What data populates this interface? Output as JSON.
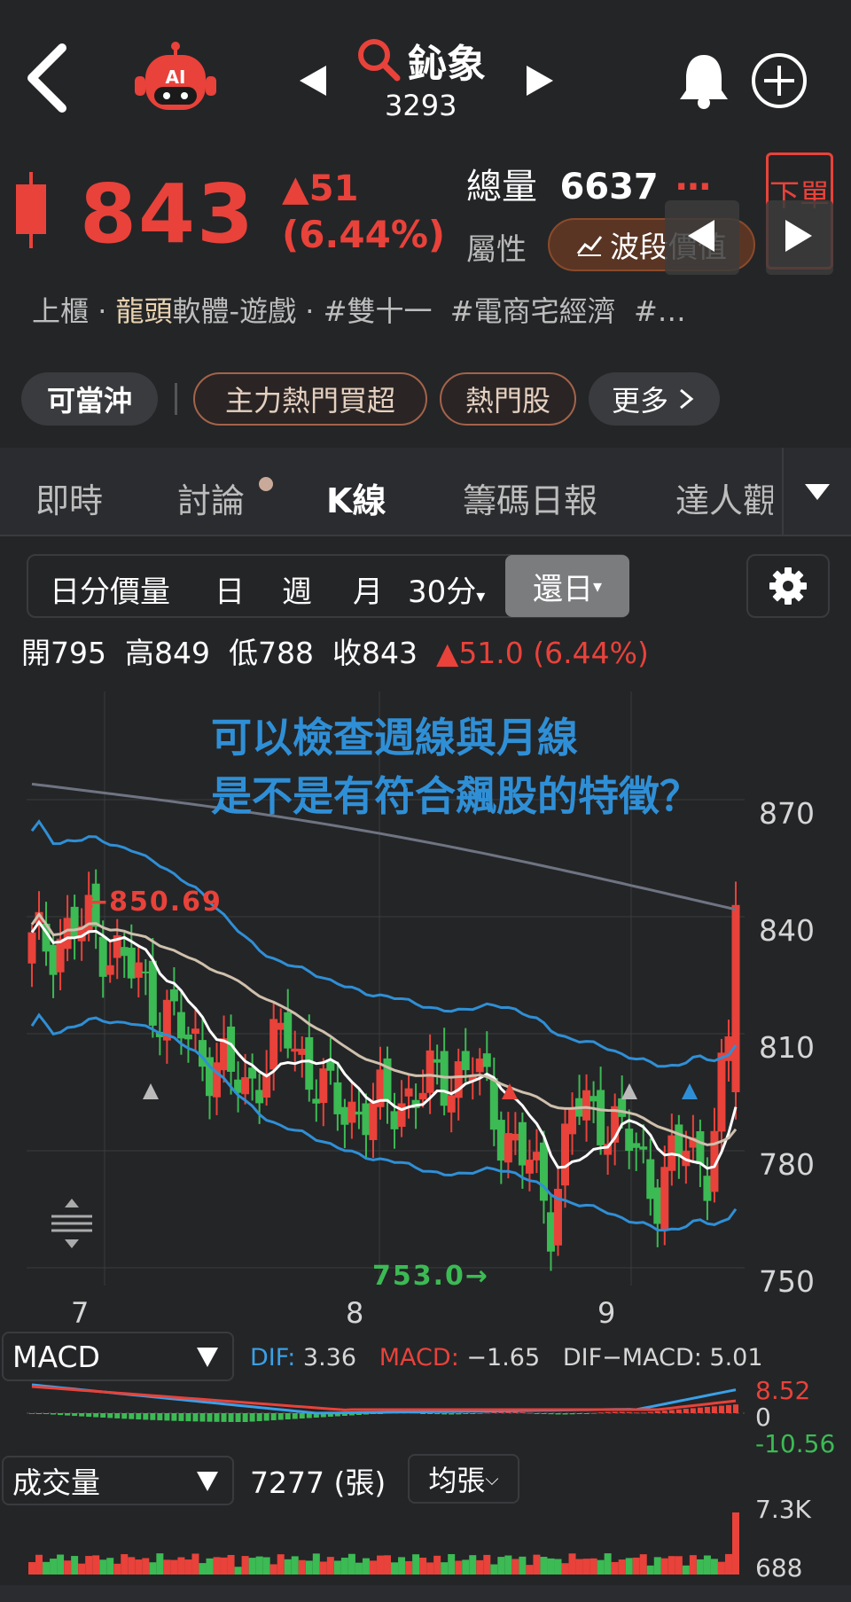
{
  "header": {
    "stock_name": "鈊象",
    "stock_code": "3293",
    "ai_label": "AI"
  },
  "quote": {
    "price": "843",
    "change": "▲51",
    "change_pct": "(6.44%)",
    "volume_label": "總量",
    "volume_value": "6637",
    "more_dots": "…",
    "attr_label": "屬性",
    "wave_button": "波段價值",
    "down_button": "下單",
    "tags": [
      "上櫃",
      "龍頭",
      "軟體-遊戲",
      "#雙十一",
      "#電商宅經濟",
      "#…"
    ]
  },
  "chips": [
    "可當沖",
    "主力熱門買超",
    "熱門股",
    "更多"
  ],
  "tabs": [
    "即時",
    "討論",
    "K線",
    "籌碼日報",
    "達人觀"
  ],
  "period": {
    "options": [
      "日分價量",
      "日",
      "週",
      "月",
      "30分",
      "還日"
    ],
    "selected": "還日"
  },
  "ohlc": {
    "open_label": "開",
    "open": "795",
    "high_label": "高",
    "high": "849",
    "low_label": "低",
    "low": "788",
    "close_label": "收",
    "close": "843",
    "change": "▲51.0 (6.44%)"
  },
  "annotation": {
    "line1": "可以檢查週線與月線",
    "line2": "是不是有符合飆股的特徵？"
  },
  "chart_data": {
    "type": "candlestick",
    "y_ticks": [
      "870",
      "840",
      "810",
      "780",
      "750"
    ],
    "ylim": [
      745,
      888
    ],
    "x_ticks": [
      "7",
      "8",
      "9"
    ],
    "high_marker": "←850.69",
    "low_marker": "753.0→",
    "colors": {
      "up": "#e8423a",
      "down": "#3cba54",
      "bollinger": "#2f8fd6",
      "ma_white": "#ffffff",
      "ma_tan": "#cfc0ad",
      "ma_grey": "#6f7482"
    }
  },
  "macd": {
    "selector": "MACD",
    "dif_label": "DIF:",
    "dif": "3.36",
    "macd_label": "MACD:",
    "macd": "−1.65",
    "diff_label": "DIF−MACD:",
    "diff": "5.01",
    "ticks": [
      "8.52",
      "0",
      "-10.56"
    ]
  },
  "volume": {
    "selector": "成交量",
    "value": "7277",
    "unit": "(張)",
    "unit_button": "均張",
    "ticks": [
      "7.3K",
      "688"
    ]
  }
}
